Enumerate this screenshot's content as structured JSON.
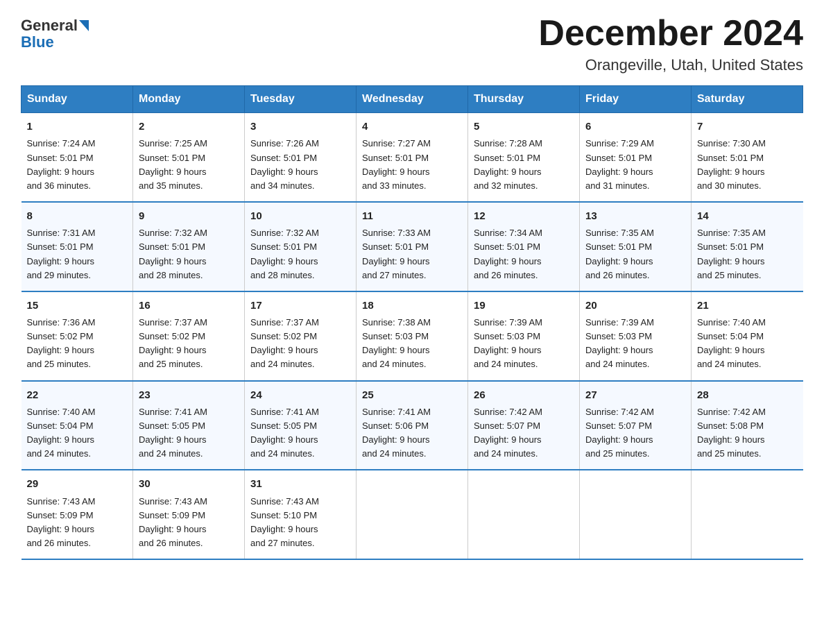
{
  "logo": {
    "general": "General",
    "blue": "Blue"
  },
  "title": "December 2024",
  "subtitle": "Orangeville, Utah, United States",
  "headers": [
    "Sunday",
    "Monday",
    "Tuesday",
    "Wednesday",
    "Thursday",
    "Friday",
    "Saturday"
  ],
  "weeks": [
    [
      {
        "day": "1",
        "sunrise": "Sunrise: 7:24 AM",
        "sunset": "Sunset: 5:01 PM",
        "daylight": "Daylight: 9 hours",
        "daylight2": "and 36 minutes."
      },
      {
        "day": "2",
        "sunrise": "Sunrise: 7:25 AM",
        "sunset": "Sunset: 5:01 PM",
        "daylight": "Daylight: 9 hours",
        "daylight2": "and 35 minutes."
      },
      {
        "day": "3",
        "sunrise": "Sunrise: 7:26 AM",
        "sunset": "Sunset: 5:01 PM",
        "daylight": "Daylight: 9 hours",
        "daylight2": "and 34 minutes."
      },
      {
        "day": "4",
        "sunrise": "Sunrise: 7:27 AM",
        "sunset": "Sunset: 5:01 PM",
        "daylight": "Daylight: 9 hours",
        "daylight2": "and 33 minutes."
      },
      {
        "day": "5",
        "sunrise": "Sunrise: 7:28 AM",
        "sunset": "Sunset: 5:01 PM",
        "daylight": "Daylight: 9 hours",
        "daylight2": "and 32 minutes."
      },
      {
        "day": "6",
        "sunrise": "Sunrise: 7:29 AM",
        "sunset": "Sunset: 5:01 PM",
        "daylight": "Daylight: 9 hours",
        "daylight2": "and 31 minutes."
      },
      {
        "day": "7",
        "sunrise": "Sunrise: 7:30 AM",
        "sunset": "Sunset: 5:01 PM",
        "daylight": "Daylight: 9 hours",
        "daylight2": "and 30 minutes."
      }
    ],
    [
      {
        "day": "8",
        "sunrise": "Sunrise: 7:31 AM",
        "sunset": "Sunset: 5:01 PM",
        "daylight": "Daylight: 9 hours",
        "daylight2": "and 29 minutes."
      },
      {
        "day": "9",
        "sunrise": "Sunrise: 7:32 AM",
        "sunset": "Sunset: 5:01 PM",
        "daylight": "Daylight: 9 hours",
        "daylight2": "and 28 minutes."
      },
      {
        "day": "10",
        "sunrise": "Sunrise: 7:32 AM",
        "sunset": "Sunset: 5:01 PM",
        "daylight": "Daylight: 9 hours",
        "daylight2": "and 28 minutes."
      },
      {
        "day": "11",
        "sunrise": "Sunrise: 7:33 AM",
        "sunset": "Sunset: 5:01 PM",
        "daylight": "Daylight: 9 hours",
        "daylight2": "and 27 minutes."
      },
      {
        "day": "12",
        "sunrise": "Sunrise: 7:34 AM",
        "sunset": "Sunset: 5:01 PM",
        "daylight": "Daylight: 9 hours",
        "daylight2": "and 26 minutes."
      },
      {
        "day": "13",
        "sunrise": "Sunrise: 7:35 AM",
        "sunset": "Sunset: 5:01 PM",
        "daylight": "Daylight: 9 hours",
        "daylight2": "and 26 minutes."
      },
      {
        "day": "14",
        "sunrise": "Sunrise: 7:35 AM",
        "sunset": "Sunset: 5:01 PM",
        "daylight": "Daylight: 9 hours",
        "daylight2": "and 25 minutes."
      }
    ],
    [
      {
        "day": "15",
        "sunrise": "Sunrise: 7:36 AM",
        "sunset": "Sunset: 5:02 PM",
        "daylight": "Daylight: 9 hours",
        "daylight2": "and 25 minutes."
      },
      {
        "day": "16",
        "sunrise": "Sunrise: 7:37 AM",
        "sunset": "Sunset: 5:02 PM",
        "daylight": "Daylight: 9 hours",
        "daylight2": "and 25 minutes."
      },
      {
        "day": "17",
        "sunrise": "Sunrise: 7:37 AM",
        "sunset": "Sunset: 5:02 PM",
        "daylight": "Daylight: 9 hours",
        "daylight2": "and 24 minutes."
      },
      {
        "day": "18",
        "sunrise": "Sunrise: 7:38 AM",
        "sunset": "Sunset: 5:03 PM",
        "daylight": "Daylight: 9 hours",
        "daylight2": "and 24 minutes."
      },
      {
        "day": "19",
        "sunrise": "Sunrise: 7:39 AM",
        "sunset": "Sunset: 5:03 PM",
        "daylight": "Daylight: 9 hours",
        "daylight2": "and 24 minutes."
      },
      {
        "day": "20",
        "sunrise": "Sunrise: 7:39 AM",
        "sunset": "Sunset: 5:03 PM",
        "daylight": "Daylight: 9 hours",
        "daylight2": "and 24 minutes."
      },
      {
        "day": "21",
        "sunrise": "Sunrise: 7:40 AM",
        "sunset": "Sunset: 5:04 PM",
        "daylight": "Daylight: 9 hours",
        "daylight2": "and 24 minutes."
      }
    ],
    [
      {
        "day": "22",
        "sunrise": "Sunrise: 7:40 AM",
        "sunset": "Sunset: 5:04 PM",
        "daylight": "Daylight: 9 hours",
        "daylight2": "and 24 minutes."
      },
      {
        "day": "23",
        "sunrise": "Sunrise: 7:41 AM",
        "sunset": "Sunset: 5:05 PM",
        "daylight": "Daylight: 9 hours",
        "daylight2": "and 24 minutes."
      },
      {
        "day": "24",
        "sunrise": "Sunrise: 7:41 AM",
        "sunset": "Sunset: 5:05 PM",
        "daylight": "Daylight: 9 hours",
        "daylight2": "and 24 minutes."
      },
      {
        "day": "25",
        "sunrise": "Sunrise: 7:41 AM",
        "sunset": "Sunset: 5:06 PM",
        "daylight": "Daylight: 9 hours",
        "daylight2": "and 24 minutes."
      },
      {
        "day": "26",
        "sunrise": "Sunrise: 7:42 AM",
        "sunset": "Sunset: 5:07 PM",
        "daylight": "Daylight: 9 hours",
        "daylight2": "and 24 minutes."
      },
      {
        "day": "27",
        "sunrise": "Sunrise: 7:42 AM",
        "sunset": "Sunset: 5:07 PM",
        "daylight": "Daylight: 9 hours",
        "daylight2": "and 25 minutes."
      },
      {
        "day": "28",
        "sunrise": "Sunrise: 7:42 AM",
        "sunset": "Sunset: 5:08 PM",
        "daylight": "Daylight: 9 hours",
        "daylight2": "and 25 minutes."
      }
    ],
    [
      {
        "day": "29",
        "sunrise": "Sunrise: 7:43 AM",
        "sunset": "Sunset: 5:09 PM",
        "daylight": "Daylight: 9 hours",
        "daylight2": "and 26 minutes."
      },
      {
        "day": "30",
        "sunrise": "Sunrise: 7:43 AM",
        "sunset": "Sunset: 5:09 PM",
        "daylight": "Daylight: 9 hours",
        "daylight2": "and 26 minutes."
      },
      {
        "day": "31",
        "sunrise": "Sunrise: 7:43 AM",
        "sunset": "Sunset: 5:10 PM",
        "daylight": "Daylight: 9 hours",
        "daylight2": "and 27 minutes."
      },
      {
        "day": "",
        "sunrise": "",
        "sunset": "",
        "daylight": "",
        "daylight2": ""
      },
      {
        "day": "",
        "sunrise": "",
        "sunset": "",
        "daylight": "",
        "daylight2": ""
      },
      {
        "day": "",
        "sunrise": "",
        "sunset": "",
        "daylight": "",
        "daylight2": ""
      },
      {
        "day": "",
        "sunrise": "",
        "sunset": "",
        "daylight": "",
        "daylight2": ""
      }
    ]
  ]
}
